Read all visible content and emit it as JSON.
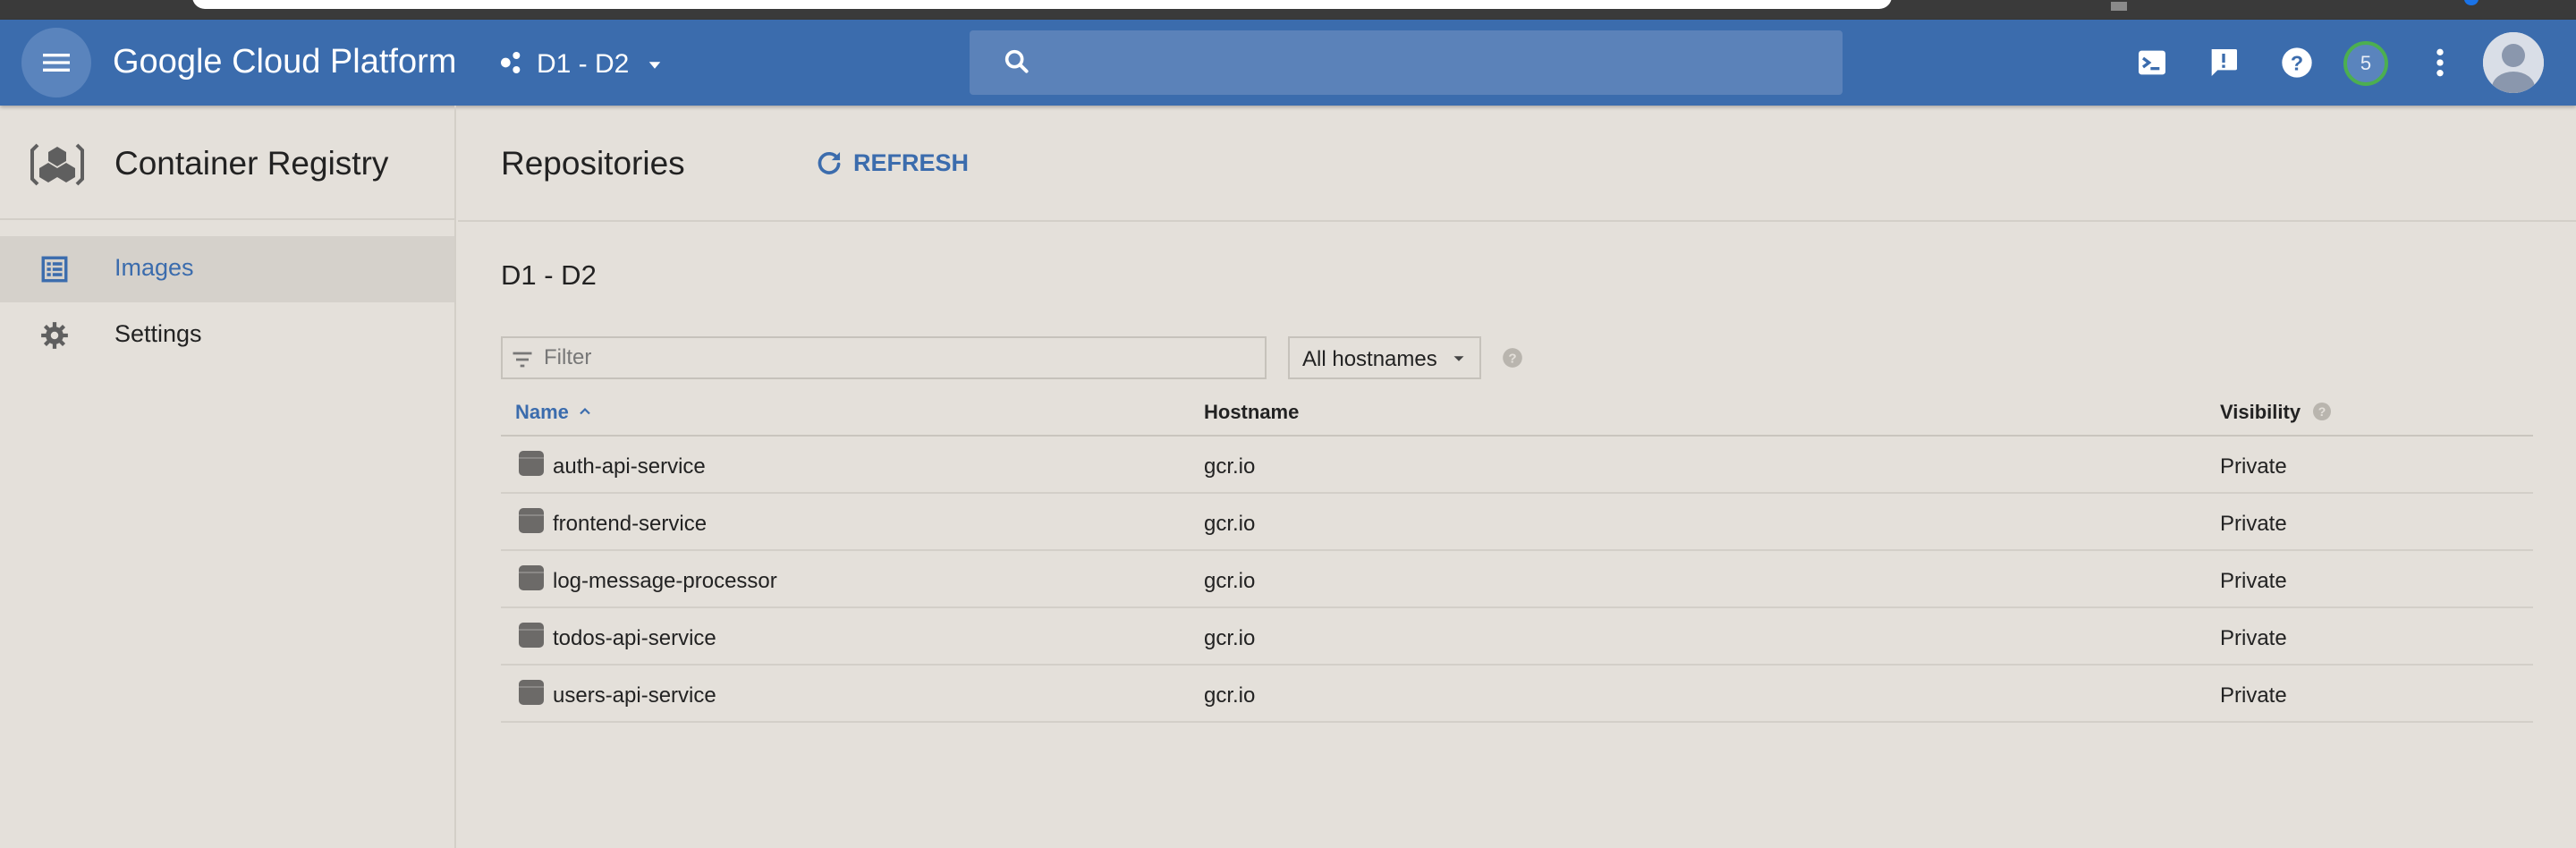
{
  "app": {
    "brand": "Google Cloud Platform",
    "project": "D1 - D2",
    "notifications_count": "5"
  },
  "icons": {
    "menu": "hamburger-icon",
    "project": "project-hub-icon",
    "search": "search-icon",
    "cloud_shell": "terminal-icon",
    "feedback": "feedback-icon",
    "help": "help-icon",
    "more": "more-vert-icon",
    "avatar": "account-avatar"
  },
  "colors": {
    "appbar": "#3b6cad",
    "accent": "#3b6cad",
    "badge_ring": "#4caf50",
    "background": "#e4e0da"
  },
  "sidebar": {
    "product_title": "Container Registry",
    "items": [
      {
        "label": "Images",
        "active": true
      },
      {
        "label": "Settings",
        "active": false
      }
    ]
  },
  "main": {
    "page_title": "Repositories",
    "refresh_label": "REFRESH",
    "section_title": "D1 - D2",
    "filter_placeholder": "Filter",
    "hostname_select": "All hostnames",
    "table": {
      "columns": [
        "Name",
        "Hostname",
        "Visibility"
      ],
      "rows": [
        {
          "name": "auth-api-service",
          "hostname": "gcr.io",
          "visibility": "Private"
        },
        {
          "name": "frontend-service",
          "hostname": "gcr.io",
          "visibility": "Private"
        },
        {
          "name": "log-message-processor",
          "hostname": "gcr.io",
          "visibility": "Private"
        },
        {
          "name": "todos-api-service",
          "hostname": "gcr.io",
          "visibility": "Private"
        },
        {
          "name": "users-api-service",
          "hostname": "gcr.io",
          "visibility": "Private"
        }
      ]
    }
  }
}
